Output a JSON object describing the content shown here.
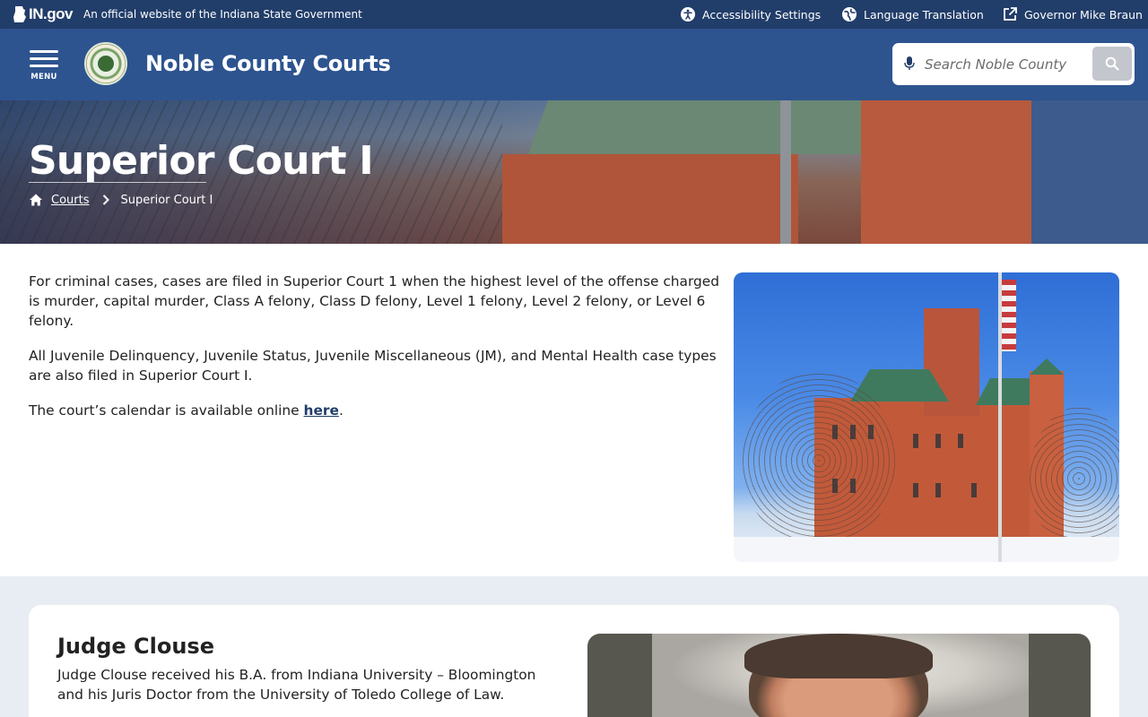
{
  "util_bar": {
    "logo_text": "IN",
    "logo_suffix": ".gov",
    "official_text": "An official website of the Indiana State Government",
    "links": [
      {
        "label": "Accessibility Settings",
        "icon": "accessibility-icon"
      },
      {
        "label": "Language Translation",
        "icon": "globe-icon"
      },
      {
        "label": "Governor Mike Braun",
        "icon": "external-link-icon"
      }
    ]
  },
  "header": {
    "menu_label": "MENU",
    "site_title": "Noble County Courts",
    "search_placeholder": "Search Noble County"
  },
  "hero": {
    "title": "Superior Court I",
    "breadcrumb": {
      "home_icon": "home-icon",
      "parent": "Courts",
      "current": "Superior Court I"
    }
  },
  "intro": {
    "p1": "For criminal cases, cases are filed in Superior Court 1 when the highest level of the offense charged is murder, capital murder, Class A felony, Class D felony, Level 1 felony, Level 2 felony, or Level 6 felony.",
    "p2": "All Juvenile Delinquency, Juvenile Status, Juvenile Miscellaneous (JM), and Mental Health case types are also filed in Superior Court I.",
    "p3_prefix": "The court’s calendar is available online ",
    "p3_link": "here",
    "p3_suffix": "."
  },
  "judge": {
    "name": "Judge Clouse",
    "bio": "Judge Clouse received his B.A. from Indiana University – Bloomington and his Juris Doctor from the University of Toledo College of Law."
  },
  "colors": {
    "util_bar_bg": "#213d69",
    "header_bg": "#2d548f",
    "link_color": "#213d69",
    "section_bg": "#e8edf3"
  }
}
